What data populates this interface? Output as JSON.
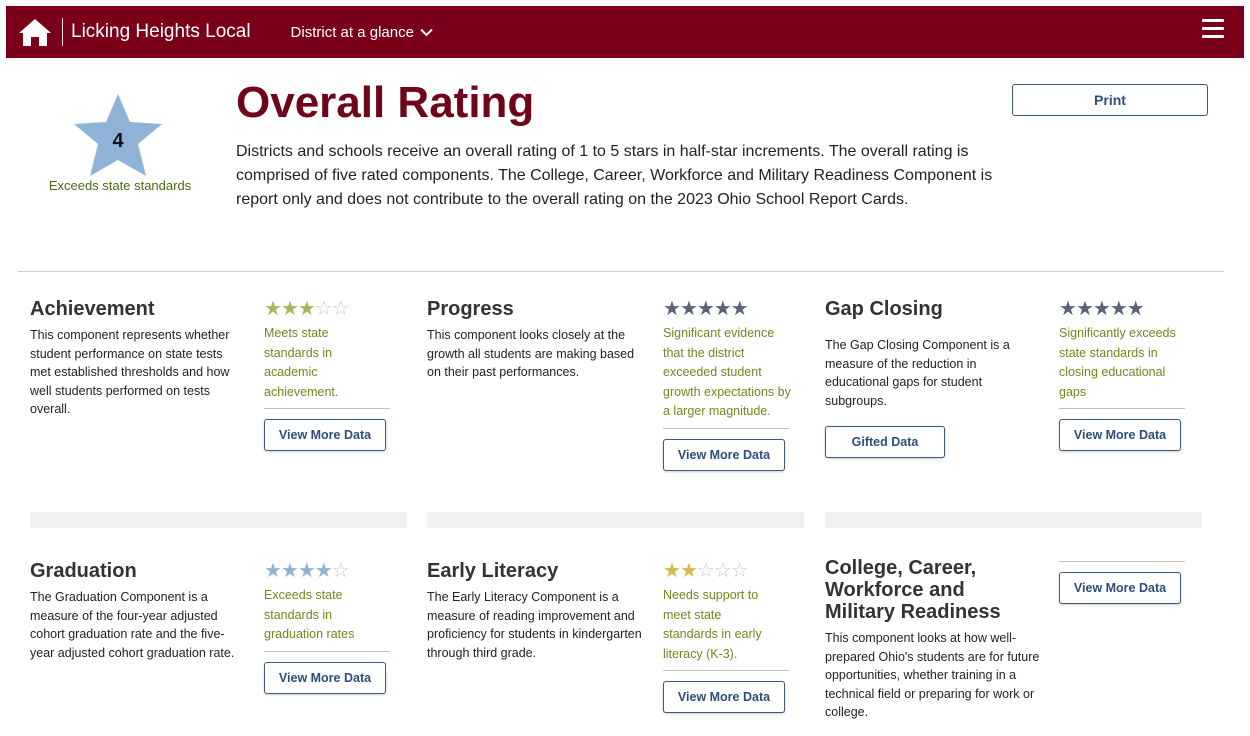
{
  "header": {
    "district_name": "Licking Heights Local",
    "nav_dropdown": "District at a glance"
  },
  "overall": {
    "title": "Overall Rating",
    "stars": 4,
    "star_color": "#8fb3d6",
    "status": "Exceeds state standards",
    "description": "Districts and schools receive an overall rating of 1 to 5 stars in half-star increments. The overall rating is comprised of five rated components. The College, Career, Workforce and Military Readiness Component is report only and does not contribute to the overall rating on the 2023 Ohio School Report Cards.",
    "print_label": "Print"
  },
  "colors": {
    "brand": "#7a0019",
    "title": "#6e0519",
    "status_green": "#4b6b10",
    "button_blue": "#2d4e7a"
  },
  "components": [
    {
      "title": "Achievement",
      "description": "This component represents whether student performance on state tests met established thresholds and how well students performed on tests overall.",
      "rating": 3,
      "star_color": "#a5b95a",
      "status": "Meets state standards in academic achievement.",
      "status_color": "#6c8a1e",
      "button": "View More Data"
    },
    {
      "title": "Progress",
      "description": "This component looks closely at the growth all students are making based on their past performances.",
      "rating": 5,
      "star_color": "#5a6478",
      "status": "Significant evidence that the district exceeded student growth expectations by a larger magnitude.",
      "status_color": "#6c8a1e",
      "button": "View More Data"
    },
    {
      "title": "Gap Closing",
      "description": "The Gap Closing Component is a measure of the reduction in educational gaps for student subgroups.",
      "rating": 5,
      "star_color": "#5a6478",
      "status": "Significantly exceeds state standards in closing educational gaps",
      "status_color": "#6c8a1e",
      "button": "View More Data",
      "extra_button": "Gifted Data"
    },
    {
      "title": "Graduation",
      "description": "The Graduation Component is a measure of the four-year adjusted cohort graduation rate and the five-year adjusted cohort graduation rate.",
      "rating": 4,
      "star_color": "#8fb3d6",
      "status": "Exceeds state standards in graduation rates",
      "status_color": "#6c8a1e",
      "button": "View More Data"
    },
    {
      "title": "Early Literacy",
      "description": "The Early Literacy Component is a measure of reading improvement and proficiency for students in kindergarten through third grade.",
      "rating": 2,
      "star_color": "#d7b94a",
      "status": "Needs support to meet state standards in early literacy (K-3).",
      "status_color": "#6c8a1e",
      "button": "View More Data"
    },
    {
      "title": "College, Career, Workforce and Military Readiness",
      "description": "This component looks at how well-prepared Ohio's students are for future opportunities, whether training in a technical field or preparing for work or college.",
      "button": "View More Data"
    }
  ]
}
